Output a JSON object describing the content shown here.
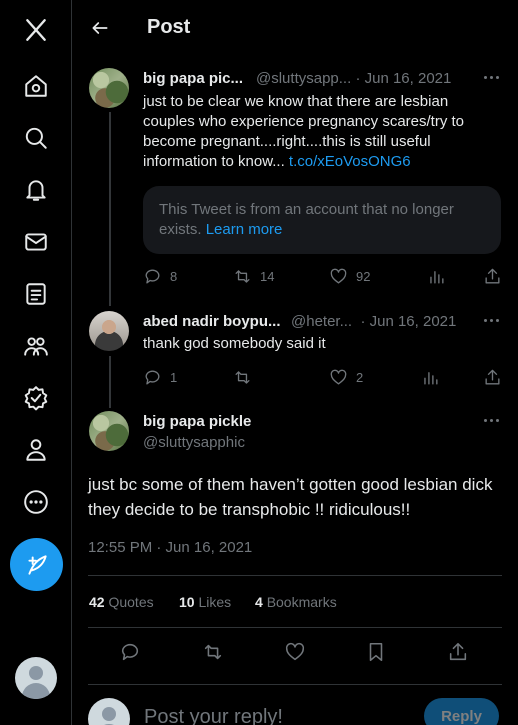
{
  "header": {
    "title": "Post"
  },
  "sidebar": {
    "items": [
      {
        "icon": "x-logo-icon"
      },
      {
        "icon": "home-icon"
      },
      {
        "icon": "search-icon"
      },
      {
        "icon": "notifications-icon"
      },
      {
        "icon": "messages-icon"
      },
      {
        "icon": "lists-icon"
      },
      {
        "icon": "communities-icon"
      },
      {
        "icon": "verified-icon"
      },
      {
        "icon": "profile-icon"
      },
      {
        "icon": "more-icon"
      }
    ],
    "compose_icon": "compose-post-icon"
  },
  "thread": [
    {
      "name": "big papa pic...",
      "handle": "@sluttysapp...",
      "date": "· Jun 16, 2021",
      "text": "just to be clear we know that there are lesbian couples who experience pregnancy scares/try to become pregnant....right....this is still useful information to know...",
      "link": "t.co/xEoVosONG6",
      "quoted_notice": "This Tweet is from an account that no longer exists.",
      "quoted_link": "Learn more",
      "replies": "8",
      "reposts": "14",
      "likes": "92"
    },
    {
      "name": "abed nadir boypu...",
      "handle": "@heter...",
      "date": "· Jun 16, 2021",
      "text": "thank god somebody said it",
      "replies": "1",
      "reposts": "",
      "likes": "2"
    }
  ],
  "main_post": {
    "name": "big papa pickle",
    "handle": "@sluttysapphic",
    "text": "just bc some of them haven’t gotten good lesbian dick they decide to be transphobic !! ridiculous!!",
    "timestamp": "12:55 PM · Jun 16, 2021",
    "quotes_count": "42",
    "quotes_label": "Quotes",
    "likes_count": "10",
    "likes_label": "Likes",
    "bookmarks_count": "4",
    "bookmarks_label": "Bookmarks"
  },
  "reply_box": {
    "placeholder": "Post your reply!",
    "button": "Reply"
  },
  "colors": {
    "background": "#000000",
    "accent": "#1d9bf0",
    "text": "#e7e9ea",
    "muted": "#71767b",
    "border": "#2f3336"
  }
}
